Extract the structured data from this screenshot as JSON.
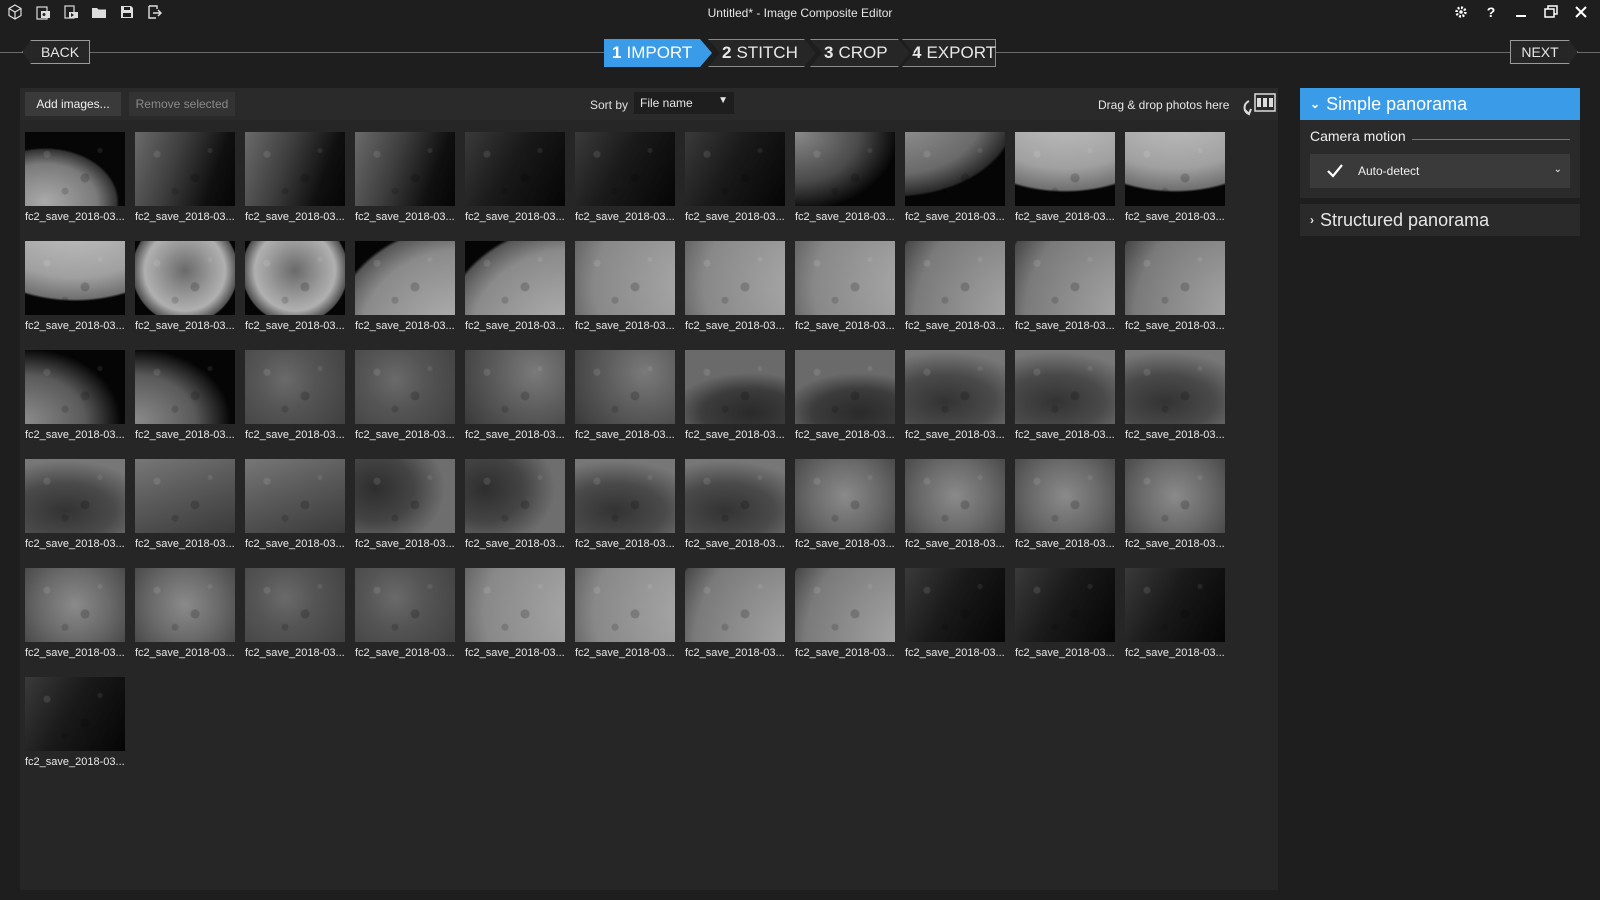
{
  "app": {
    "window_title": "Untitled* - Image Composite Editor"
  },
  "titlebar_icons": [
    "new-project-icon",
    "import-photos-icon",
    "import-video-icon",
    "open-icon",
    "save-icon",
    "export-icon"
  ],
  "window_buttons": [
    "settings-icon",
    "help-icon",
    "minimize-icon",
    "restore-icon",
    "close-icon"
  ],
  "help_glyph": "?",
  "nav": {
    "back_label": "BACK",
    "next_label": "NEXT"
  },
  "steps": [
    {
      "num": "1",
      "label": "IMPORT",
      "active": true
    },
    {
      "num": "2",
      "label": "STITCH",
      "active": false
    },
    {
      "num": "3",
      "label": "CROP",
      "active": false
    },
    {
      "num": "4",
      "label": "EXPORT",
      "active": false
    }
  ],
  "toolbar": {
    "add_images": "Add images...",
    "remove_selected": "Remove selected",
    "sort_label": "Sort by",
    "sort_value": "File name",
    "drop_label": "Drag & drop photos here"
  },
  "thumbnails": {
    "label": "fc2_save_2018-03...",
    "rows": [
      [
        "m-edgeA",
        "m-dimRight",
        "m-dimRight",
        "m-dimRight",
        "m-dark",
        "m-dark",
        "m-dark",
        "m-cornerTL",
        "m-limbBR",
        "m-topBright",
        "m-topBright"
      ],
      [
        "m-topBright",
        "m-mariaB",
        "m-mariaB",
        "m-arcR",
        "m-arcR",
        "m-arcL",
        "m-arcL",
        "m-arcL",
        "m-limbL",
        "m-limbL",
        "m-limbL"
      ],
      [
        "m-edgeB",
        "m-edgeB",
        "m-flat1",
        "m-flat1",
        "m-flat2",
        "m-flat2",
        "m-maria1",
        "m-maria1",
        "m-maria2",
        "m-maria2",
        "m-maria2"
      ],
      [
        "m-maria2",
        "m-flat3",
        "m-flat3",
        "m-maria3",
        "m-maria3",
        "m-maria2",
        "m-maria2",
        "m-bright",
        "m-bright",
        "m-bright",
        "m-bright"
      ],
      [
        "m-bright",
        "m-bright",
        "m-flat1",
        "m-flat1",
        "m-arcL",
        "m-arcL",
        "m-limbL",
        "m-limbL",
        "m-dark",
        "m-dark",
        "m-dark"
      ],
      [
        "m-dark"
      ]
    ]
  },
  "side_panel": {
    "simple_panorama": "Simple panorama",
    "camera_motion_label": "Camera motion",
    "camera_motion_value": "Auto-detect",
    "structured_panorama": "Structured panorama"
  },
  "colors": {
    "accent": "#3a9be8",
    "background": "#1e1e1e",
    "panel": "#262626"
  }
}
